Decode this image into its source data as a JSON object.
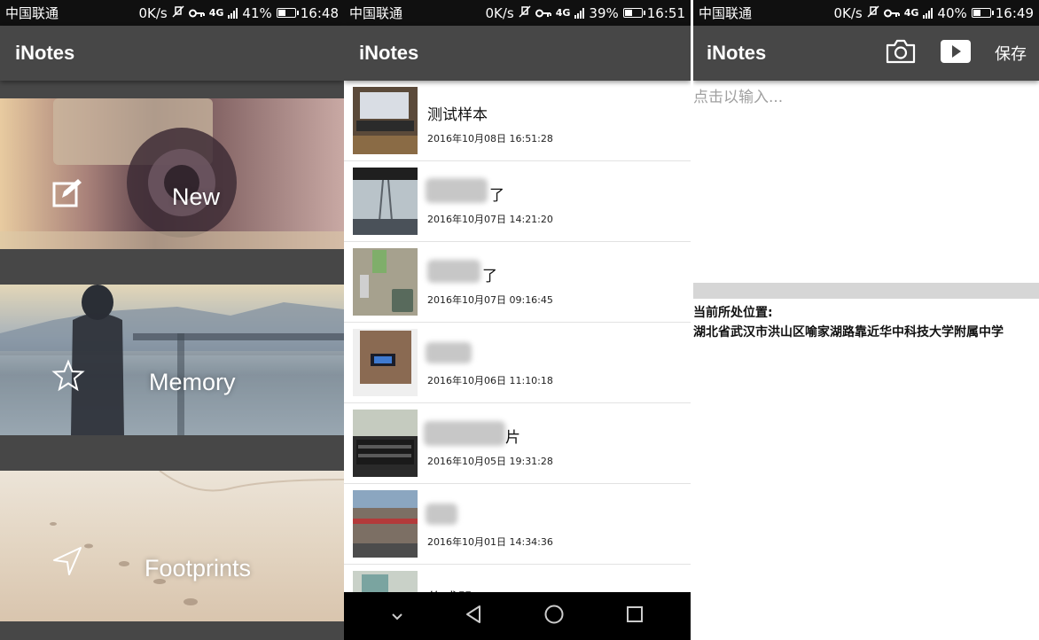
{
  "screens": [
    {
      "status": {
        "carrier": "中国联通",
        "speed": "0K/s",
        "network": "4G",
        "battery": "41%",
        "battery_level": 0.41,
        "time": "16:48"
      },
      "title": "iNotes",
      "menu": [
        {
          "label": "New",
          "icon": "edit-icon"
        },
        {
          "label": "Memory",
          "icon": "star-icon"
        },
        {
          "label": "Footprints",
          "icon": "navigation-arrow-icon"
        }
      ]
    },
    {
      "status": {
        "carrier": "中国联通",
        "speed": "0K/s",
        "network": "4G",
        "battery": "39%",
        "battery_level": 0.39,
        "time": "16:51"
      },
      "title": "iNotes",
      "notes": [
        {
          "title": "测试样本",
          "date": "2016年10月08日 16:51:28"
        },
        {
          "title": "了",
          "date": "2016年10月07日 14:21:20"
        },
        {
          "title": "了",
          "date": "2016年10月07日 09:16:45"
        },
        {
          "title": "",
          "date": "2016年10月06日 11:10:18"
        },
        {
          "title": "片",
          "date": "2016年10月05日 19:31:28"
        },
        {
          "title": "",
          "date": "2016年10月01日 14:34:36"
        },
        {
          "title": "传感器",
          "date": ""
        }
      ],
      "navbar": [
        "chevron-down-icon",
        "back-triangle-icon",
        "home-circle-icon",
        "recents-square-icon"
      ]
    },
    {
      "status": {
        "carrier": "中国联通",
        "speed": "0K/s",
        "network": "4G",
        "battery": "40%",
        "battery_level": 0.4,
        "time": "16:49"
      },
      "title": "iNotes",
      "actions": {
        "camera_icon": "camera-icon",
        "video_icon": "video-play-icon",
        "save_label": "保存"
      },
      "editor": {
        "placeholder": "点击以输入..."
      },
      "location": {
        "label": "当前所处位置:",
        "address": "湖北省武汉市洪山区喻家湖路靠近华中科技大学附属中学"
      }
    }
  ],
  "colors": {
    "appbar": "#474747",
    "statusbar": "#101010",
    "navbar": "#000000"
  }
}
